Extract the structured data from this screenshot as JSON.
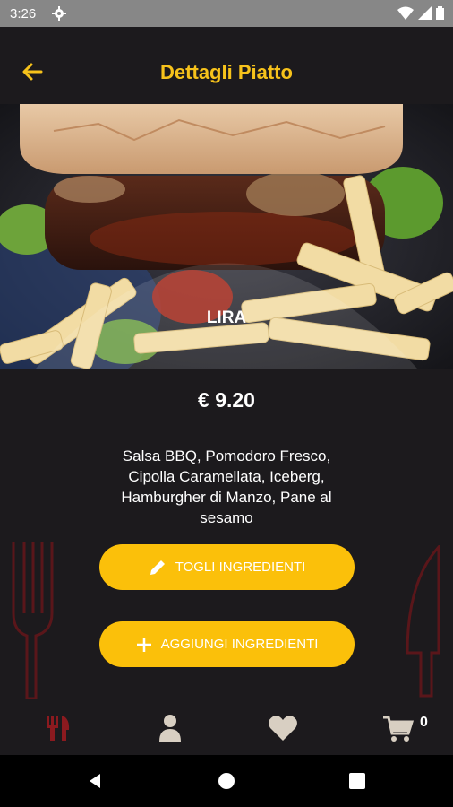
{
  "status": {
    "time": "3:26"
  },
  "header": {
    "title": "Dettagli Piatto"
  },
  "dish": {
    "name": "LIRA",
    "price": "€ 9.20",
    "ingredients": "Salsa BBQ, Pomodoro Fresco, Cipolla Caramellata, Iceberg, Hamburgher di Manzo, Pane al sesamo"
  },
  "actions": {
    "remove_label": "TOGLI INGREDIENTI",
    "add_label": "AGGIUNGI INGREDIENTI"
  },
  "bottom_nav": {
    "items": [
      {
        "icon": "cutlery-icon",
        "active": true
      },
      {
        "icon": "user-icon",
        "active": false
      },
      {
        "icon": "heart-icon",
        "active": false
      },
      {
        "icon": "cart-icon",
        "active": false
      }
    ],
    "cart_count": "0"
  },
  "colors": {
    "accent": "#f6c21b",
    "button": "#fbc00a",
    "active_nav": "#8b1a1f",
    "background": "#1c1a1d"
  }
}
